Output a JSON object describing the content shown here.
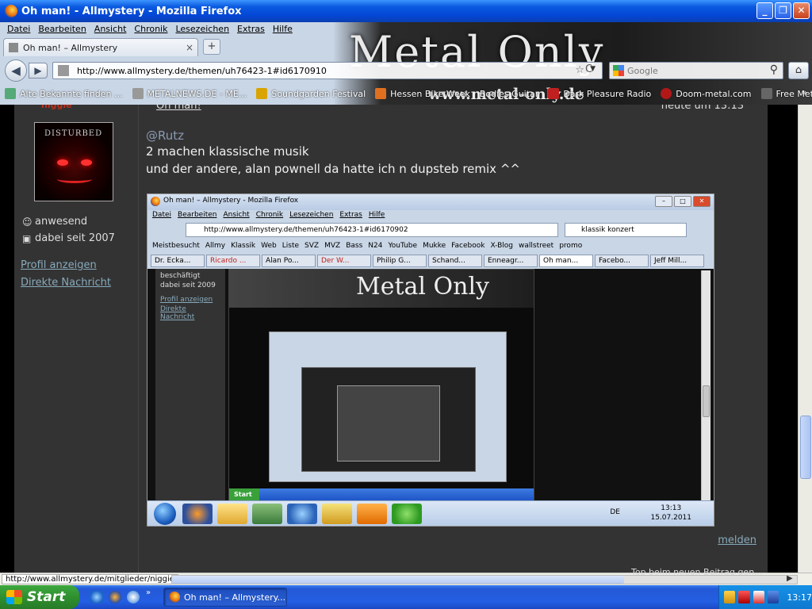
{
  "window": {
    "title": "Oh man! - Allmystery - Mozilla Firefox",
    "min_label": "_",
    "max_label": "❐",
    "close_label": "✕"
  },
  "menu": [
    "Datei",
    "Bearbeiten",
    "Ansicht",
    "Chronik",
    "Lesezeichen",
    "Extras",
    "Hilfe"
  ],
  "tab": {
    "label": "Oh man! – Allmystery",
    "close": "×",
    "new_tab": "+"
  },
  "nav": {
    "url": "http://www.allmystery.de/themen/uh76423-1#id6170910",
    "search_placeholder": "Google",
    "back": "◀",
    "forward": "▶",
    "reload": "C",
    "home": "⌂",
    "search_icon": "⚲"
  },
  "banner": {
    "logo": "Metal Only",
    "url": "www.metal-only.de"
  },
  "bookmarks": [
    {
      "label": "Alte Bekannte finden ...",
      "icon": "people-icon"
    },
    {
      "label": "METALNEWS.DE - ME...",
      "icon": "metalnews-icon"
    },
    {
      "label": "Soundgarden Festival",
      "icon": "sg-icon"
    },
    {
      "label": "Hessen Bike Week",
      "icon": "h-icon"
    },
    {
      "label": "Bodies Guitar",
      "icon": "guitar-icon"
    },
    {
      "label": "Dark Pleasure Radio",
      "icon": "dpr-icon"
    },
    {
      "label": "Doom-metal.com",
      "icon": "d-icon"
    },
    {
      "label": "Free Metal Albums",
      "icon": "fma-icon"
    }
  ],
  "bookmarks_more": "»",
  "sidebar": {
    "tag": "niggie",
    "avatar_band": "DISTURBED",
    "status": "anwesend",
    "member_since": "dabei seit 2007",
    "profile_link": "Profil anzeigen",
    "message_link": "Direkte Nachricht"
  },
  "post": {
    "topline": "Oh man!",
    "time": "heute um 13:13",
    "mention": "@Rutz",
    "line1": "2 machen klassische musik",
    "line2": "und der andere, alan pownell da hatte ich n dupsteb remix ^^",
    "report": "melden"
  },
  "embed": {
    "title": "Oh man! – Allmystery - Mozilla Firefox",
    "menu": [
      "Datei",
      "Bearbeiten",
      "Ansicht",
      "Chronik",
      "Lesezeichen",
      "Extras",
      "Hilfe"
    ],
    "url": "http://www.allmystery.de/themen/uh76423-1#id6170902",
    "search": "klassik konzert",
    "bookmarks": [
      "Meistbesucht",
      "Allmy",
      "Klassik",
      "Web",
      "Liste",
      "SVZ",
      "MVZ",
      "Bass",
      "N24",
      "YouTube",
      "Mukke",
      "Facebook",
      "X-Blog",
      "wallstreet",
      "promo"
    ],
    "tabs": [
      "Dr. Ecka...",
      "Ricardo ...",
      "Alan Po...",
      "Der W...",
      "Philip G...",
      "Schand...",
      "Enneagr...",
      "Oh man...",
      "Facebo...",
      "Jeff Mill..."
    ],
    "side_status": "beschäftigt",
    "side_since": "dabei seit 2009",
    "side_profile": "Profil anzeigen",
    "side_message": "Direkte Nachricht",
    "nested_logo": "Metal Only",
    "nested_start": "Start",
    "lang": "DE",
    "clock_time": "13:13",
    "clock_date": "15.07.2011"
  },
  "statusbar": {
    "url": "http://www.allmystery.de/mitglieder/niggie",
    "note": "Top    beim neuen Beitrag gen..."
  },
  "taskbar": {
    "start": "Start",
    "task_item": "Oh man! – Allmystery...",
    "clock": "13:17"
  },
  "colors": {
    "xp_blue": "#245ee3",
    "start_green": "#2f8f2f",
    "forum_bg": "#333333",
    "link": "#88aabb"
  }
}
